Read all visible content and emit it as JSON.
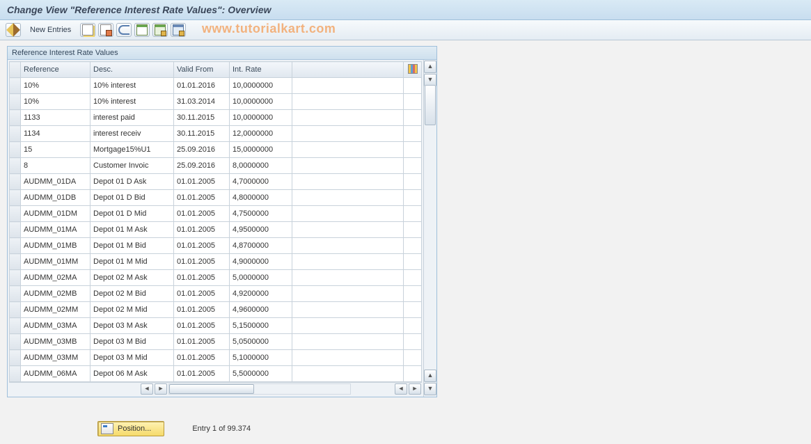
{
  "title": "Change View \"Reference Interest Rate Values\": Overview",
  "toolbar": {
    "new_entries": "New Entries"
  },
  "watermark": "www.tutorialkart.com",
  "panel": {
    "title": "Reference Interest Rate Values",
    "columns": {
      "reference": "Reference",
      "desc": "Desc.",
      "valid_from": "Valid From",
      "int_rate": "Int. Rate"
    }
  },
  "rows": [
    {
      "ref": "10%",
      "desc": "10% interest",
      "from": "01.01.2016",
      "rate": "10,0000000"
    },
    {
      "ref": "10%",
      "desc": "10% interest",
      "from": "31.03.2014",
      "rate": "10,0000000"
    },
    {
      "ref": "1133",
      "desc": "interest paid",
      "from": "30.11.2015",
      "rate": "10,0000000"
    },
    {
      "ref": "1134",
      "desc": "interest receiv",
      "from": "30.11.2015",
      "rate": "12,0000000"
    },
    {
      "ref": "15",
      "desc": "Mortgage15%U1",
      "from": "25.09.2016",
      "rate": "15,0000000"
    },
    {
      "ref": "8",
      "desc": "Customer Invoic",
      "from": "25.09.2016",
      "rate": "8,0000000"
    },
    {
      "ref": "AUDMM_01DA",
      "desc": "Depot 01 D Ask",
      "from": "01.01.2005",
      "rate": "4,7000000"
    },
    {
      "ref": "AUDMM_01DB",
      "desc": "Depot 01 D Bid",
      "from": "01.01.2005",
      "rate": "4,8000000"
    },
    {
      "ref": "AUDMM_01DM",
      "desc": "Depot 01 D Mid",
      "from": "01.01.2005",
      "rate": "4,7500000"
    },
    {
      "ref": "AUDMM_01MA",
      "desc": "Depot 01 M Ask",
      "from": "01.01.2005",
      "rate": "4,9500000"
    },
    {
      "ref": "AUDMM_01MB",
      "desc": "Depot 01 M Bid",
      "from": "01.01.2005",
      "rate": "4,8700000"
    },
    {
      "ref": "AUDMM_01MM",
      "desc": "Depot 01 M Mid",
      "from": "01.01.2005",
      "rate": "4,9000000"
    },
    {
      "ref": "AUDMM_02MA",
      "desc": "Depot 02 M Ask",
      "from": "01.01.2005",
      "rate": "5,0000000"
    },
    {
      "ref": "AUDMM_02MB",
      "desc": "Depot 02 M Bid",
      "from": "01.01.2005",
      "rate": "4,9200000"
    },
    {
      "ref": "AUDMM_02MM",
      "desc": "Depot 02 M Mid",
      "from": "01.01.2005",
      "rate": "4,9600000"
    },
    {
      "ref": "AUDMM_03MA",
      "desc": "Depot 03 M Ask",
      "from": "01.01.2005",
      "rate": "5,1500000"
    },
    {
      "ref": "AUDMM_03MB",
      "desc": "Depot 03 M Bid",
      "from": "01.01.2005",
      "rate": "5,0500000"
    },
    {
      "ref": "AUDMM_03MM",
      "desc": "Depot 03 M Mid",
      "from": "01.01.2005",
      "rate": "5,1000000"
    },
    {
      "ref": "AUDMM_06MA",
      "desc": "Depot 06 M Ask",
      "from": "01.01.2005",
      "rate": "5,5000000"
    }
  ],
  "footer": {
    "position_label": "Position...",
    "entry_text": "Entry 1 of 99.374"
  }
}
